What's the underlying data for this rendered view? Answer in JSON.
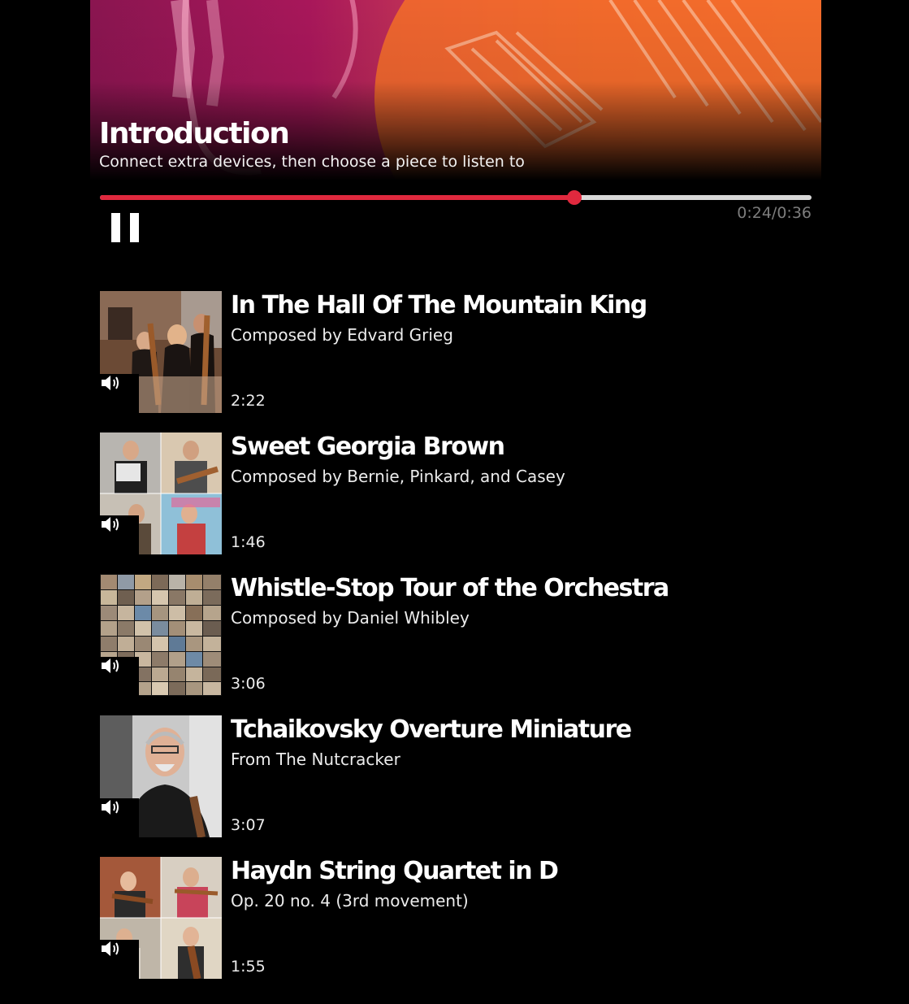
{
  "hero": {
    "title": "Introduction",
    "subtitle": "Connect extra devices, then choose a piece to listen to"
  },
  "player": {
    "progress_fraction": 0.667,
    "time_text": "0:24/0:36",
    "state": "playing",
    "pause_icon": "pause-icon",
    "accent_color": "#e0293e",
    "track_color": "#d8d8d8"
  },
  "tracks": [
    {
      "title": "In The Hall Of The Mountain King",
      "subtitle": "Composed by Edvard Grieg",
      "duration": "2:22",
      "icon": "speaker-icon"
    },
    {
      "title": "Sweet Georgia Brown",
      "subtitle": "Composed by Bernie, Pinkard, and Casey",
      "duration": "1:46",
      "icon": "speaker-icon"
    },
    {
      "title": "Whistle-Stop Tour of the Orchestra",
      "subtitle": "Composed by Daniel Whibley",
      "duration": "3:06",
      "icon": "speaker-icon"
    },
    {
      "title": "Tchaikovsky Overture Miniature",
      "subtitle": "From The Nutcracker",
      "duration": "3:07",
      "icon": "speaker-icon"
    },
    {
      "title": "Haydn String Quartet in D",
      "subtitle": "Op. 20 no. 4 (3rd movement)",
      "duration": "1:55",
      "icon": "speaker-icon"
    }
  ]
}
